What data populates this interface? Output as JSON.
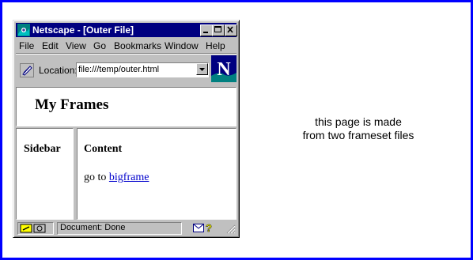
{
  "window": {
    "title": "Netscape - [Outer File]",
    "controls": [
      "minimize-icon",
      "maximize-icon",
      "close-icon"
    ]
  },
  "menu": {
    "items": [
      "File",
      "Edit",
      "View",
      "Go",
      "Bookmarks",
      "Window",
      "Help"
    ]
  },
  "location": {
    "label": "Location:",
    "value": "file:///temp/outer.html"
  },
  "frames": {
    "top_heading": "My Frames",
    "sidebar_label": "Sidebar",
    "content_heading": "Content",
    "content_text": "go to ",
    "content_link": "bigframe"
  },
  "status": {
    "text": "Document: Done"
  },
  "caption": {
    "line1": "this page is made",
    "line2": "from two frameset files"
  },
  "colors": {
    "outer_border": "#0000ff",
    "title_bar": "#000080",
    "link": "#0000cc",
    "chrome": "#c0c0c0"
  }
}
